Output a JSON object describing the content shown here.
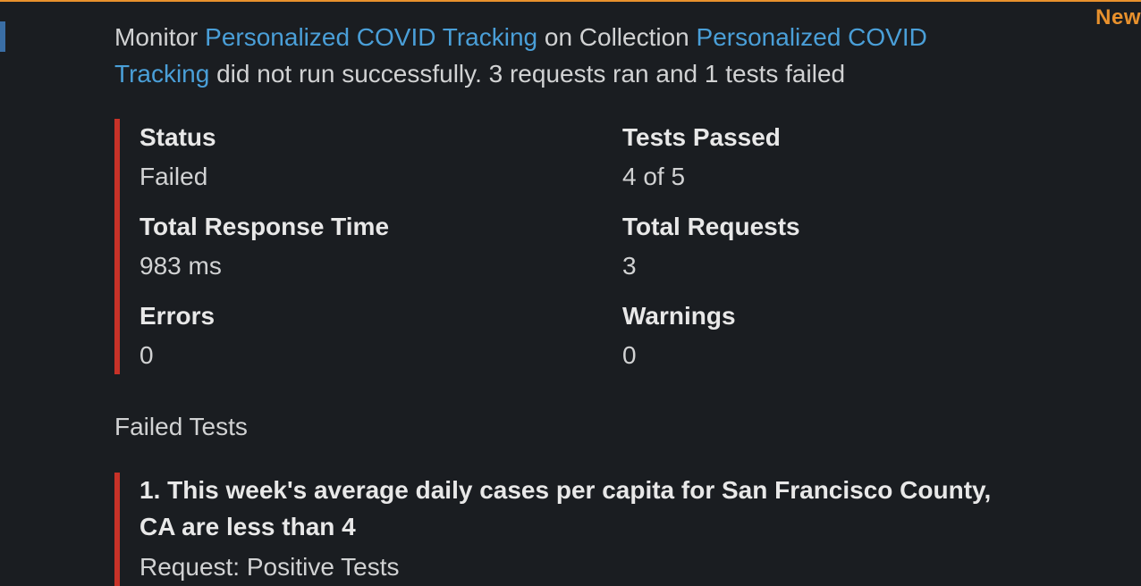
{
  "badge": {
    "new": "New"
  },
  "intro": {
    "prefix": "Monitor ",
    "monitor_link": "Personalized COVID Tracking",
    "middle": " on Collection ",
    "collection_link": "Personalized COVID Tracking",
    "suffix": " did not run successfully. 3 requests ran and 1 tests failed"
  },
  "stats": {
    "status_label": "Status",
    "status_value": "Failed",
    "tests_passed_label": "Tests Passed",
    "tests_passed_value": "4 of 5",
    "response_time_label": "Total Response Time",
    "response_time_value": "983 ms",
    "total_requests_label": "Total Requests",
    "total_requests_value": "3",
    "errors_label": "Errors",
    "errors_value": "0",
    "warnings_label": "Warnings",
    "warnings_value": "0"
  },
  "failed_tests": {
    "heading": "Failed Tests",
    "item_title": "1. This week's average daily cases per capita for San Francisco County, CA are less than 4",
    "item_request": "Request: Positive Tests"
  }
}
